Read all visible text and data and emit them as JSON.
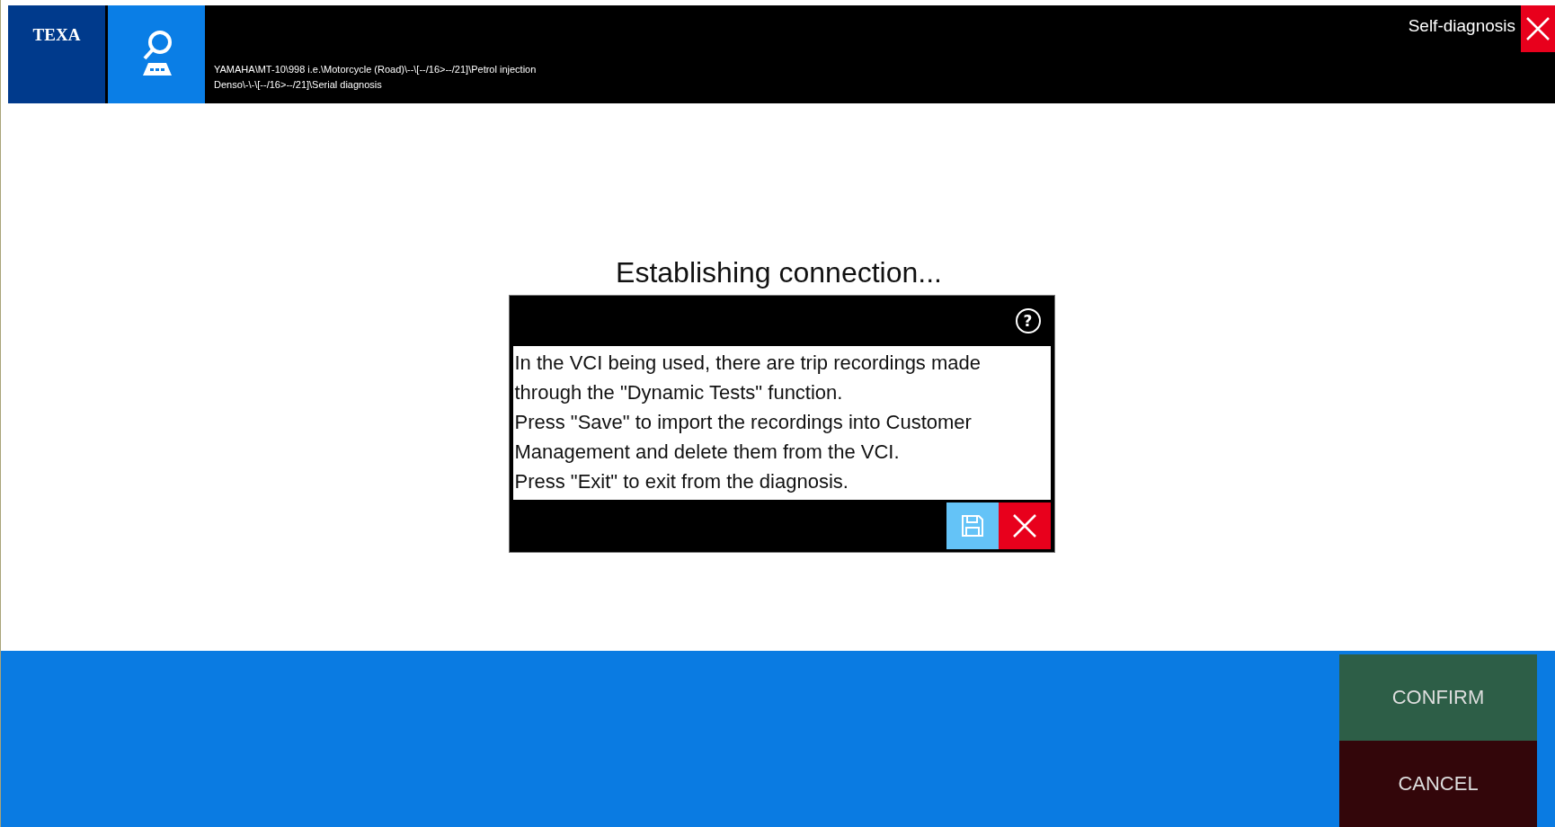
{
  "header": {
    "logo": "TEXA",
    "path_lines": [
      "YAMAHA\\MT-10\\998 i.e.\\Motorcycle (Road)\\--\\[--/16>--/21]\\Petrol injection",
      "Denso\\-\\-\\[--/16>--/21]\\Serial diagnosis"
    ],
    "title": "Self-diagnosis"
  },
  "status": "Establishing connection...",
  "dialog": {
    "help": "?",
    "paragraphs": [
      "In the VCI being used, there are trip recordings made through the \"Dynamic Tests\" function.",
      "Press \"Save\" to import the recordings into Customer Management and delete them from the VCI.",
      "Press \"Exit\" to exit from the diagnosis."
    ]
  },
  "footer": {
    "buttons": [
      {
        "label": "CONFIRM",
        "kind": "confirm"
      },
      {
        "label": "CANCEL",
        "kind": "cancel"
      }
    ]
  }
}
